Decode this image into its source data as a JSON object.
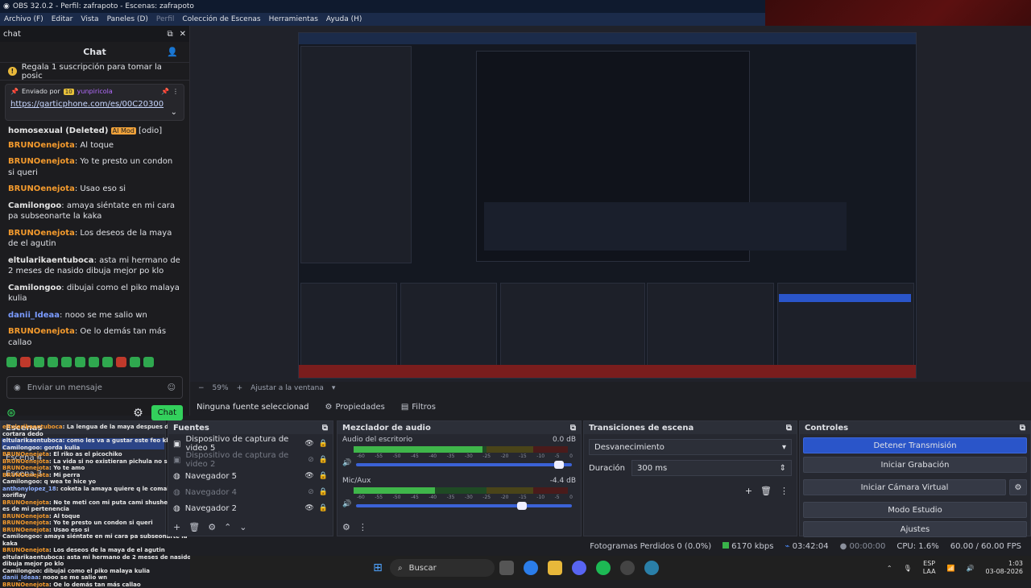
{
  "window": {
    "title": "OBS 32.0.2 - Perfil: zafrapoto - Escenas: zafrapoto"
  },
  "menu": {
    "items": [
      "Archivo (F)",
      "Editar",
      "Vista",
      "Paneles (D)",
      "Perfil",
      "Colección de Escenas",
      "Herramientas",
      "Ayuda (H)"
    ]
  },
  "chat_dock": {
    "dock_title": "chat",
    "header": "Chat",
    "banner": "Regala 1 suscripción para tomar la posic",
    "pinned": {
      "sent_by": "Enviado por",
      "badge": "10",
      "user": "yunpiricola",
      "link": "https://garticphone.com/es/00C20300"
    },
    "partial_line": {
      "user": "homosexual (Deleted)",
      "badge": "AI Mod",
      "text": "[odio]"
    },
    "messages": [
      {
        "user": "BRUNOenejota",
        "text": "Al toque",
        "color": "o"
      },
      {
        "user": "BRUNOenejota",
        "text": "Yo te presto un condon si queri",
        "color": "o"
      },
      {
        "user": "BRUNOenejota",
        "text": "Usao eso si",
        "color": "o"
      },
      {
        "user": "Camilongoo",
        "text": "amaya siéntate en mi cara pa subseonarte la kaka",
        "color": "w"
      },
      {
        "user": "BRUNOenejota",
        "text": "Los deseos de la maya de el agutin",
        "color": "o"
      },
      {
        "user": "eltularikaentuboca",
        "text": "asta mi hermano de 2 meses de nasido dibuja mejor po klo",
        "color": "w"
      },
      {
        "user": "Camilongoo",
        "text": "dibujai como el piko malaya kulia",
        "color": "w"
      },
      {
        "user": "danii_Ideaa",
        "text": "nooo se me salio wn",
        "color": "b"
      },
      {
        "user": "BRUNOenejota",
        "text": "Oe lo demás tan más callao",
        "color": "o"
      }
    ],
    "input_placeholder": "Enviar un mensaje",
    "send_label": "Chat"
  },
  "preview": {
    "zoom": "59%",
    "fit_label": "Ajustar a la ventana"
  },
  "source_toolbar": {
    "no_source": "Ninguna fuente seleccionad",
    "properties": "Propiedades",
    "filters": "Filtros"
  },
  "scenes_dock": {
    "title": "Escenas",
    "scenes": [
      "Escena 4",
      "Escena 3"
    ],
    "overlay_lines": [
      {
        "user": "eltularikaentuboca",
        "text": "La lengua de la maya despues de que se cortara dedo",
        "c": "o"
      },
      {
        "user": "eltularikaentuboca",
        "text": "como les va a gustar este feo klo",
        "c": "w"
      },
      {
        "user": "Camilongoo",
        "text": "gorda kulia",
        "c": "w"
      },
      {
        "user": "BRUNOenejota",
        "text": "El riko as el picochiko",
        "c": "o"
      },
      {
        "user": "BRUNOenejota",
        "text": "La vida si no existieran pichula no seria vida",
        "c": "o"
      },
      {
        "user": "BRUNOenejota",
        "text": "Yo te amo",
        "c": "o"
      },
      {
        "user": "BRUNOenejota",
        "text": "Mi perra",
        "c": "o"
      },
      {
        "user": "Camilongoo",
        "text": "q wea te hice yo",
        "c": "w"
      },
      {
        "user": "anthonylopez_18",
        "text": "coketa la amaya quiere q le comai el xoriflay",
        "c": "b"
      },
      {
        "user": "BRUNOenejota",
        "text": "No te meti con mi puta cami shushetumare es de mi pertenencia",
        "c": "o"
      },
      {
        "user": "BRUNOenejota",
        "text": "Al toque",
        "c": "o"
      },
      {
        "user": "BRUNOenejota",
        "text": "Yo te presto un condon si queri",
        "c": "o"
      },
      {
        "user": "BRUNOenejota",
        "text": "Usao eso si",
        "c": "o"
      },
      {
        "user": "Camilongoo",
        "text": "amaya siéntate en mi cara pa subseonarte la kaka",
        "c": "w"
      },
      {
        "user": "BRUNOenejota",
        "text": "Los deseos de la maya de el agutin",
        "c": "o"
      },
      {
        "user": "eltularikaentuboca",
        "text": "asta mi hermano de 2 meses de nasido dibuja mejor po klo",
        "c": "w"
      },
      {
        "user": "Camilongoo",
        "text": "dibujai como el piko malaya kulia",
        "c": "w"
      },
      {
        "user": "danii_Ideaa",
        "text": "nooo se me salio wn",
        "c": "b"
      },
      {
        "user": "BRUNOenejota",
        "text": "Oe lo demás tan más callao",
        "c": "o"
      }
    ]
  },
  "sources_dock": {
    "title": "Fuentes",
    "sources": [
      {
        "name": "Dispositivo de captura de video 5",
        "visible": true
      },
      {
        "name": "Dispositivo de captura de video 2",
        "visible": false
      },
      {
        "name": "Navegador 5",
        "visible": true
      },
      {
        "name": "Navegador 4",
        "visible": false
      },
      {
        "name": "Navegador 2",
        "visible": true
      }
    ]
  },
  "mixer_dock": {
    "title": "Mezclador de audio",
    "channels": [
      {
        "name": "Audio del escritorio",
        "db": "0.0 dB",
        "level": 0.6,
        "volume": 0.96
      },
      {
        "name": "Mic/Aux",
        "db": "-4.4 dB",
        "level": 0.38,
        "volume": 0.78
      }
    ],
    "ticks": [
      "-60",
      "-55",
      "-50",
      "-45",
      "-40",
      "-35",
      "-30",
      "-25",
      "-20",
      "-15",
      "-10",
      "-5",
      "0"
    ]
  },
  "transitions_dock": {
    "title": "Transiciones de escena",
    "transition": "Desvanecimiento",
    "duration_label": "Duración",
    "duration": "300 ms"
  },
  "controls_dock": {
    "title": "Controles",
    "buttons": [
      "Detener Transmisión",
      "Iniciar Grabación",
      "Iniciar Cámara Virtual",
      "Modo Estudio",
      "Ajustes"
    ]
  },
  "status": {
    "dropped": "Fotogramas Perdidos 0 (0.0%)",
    "bitrate": "6170 kbps",
    "live_time": "03:42:04",
    "rec_time": "00:00:00",
    "cpu": "CPU: 1.6%",
    "fps": "60.00 / 60.00 FPS"
  },
  "taskbar": {
    "search": "Buscar",
    "lang": "ESP",
    "lang2": "LAA",
    "time": "1:03",
    "date": "03-08-2026"
  }
}
